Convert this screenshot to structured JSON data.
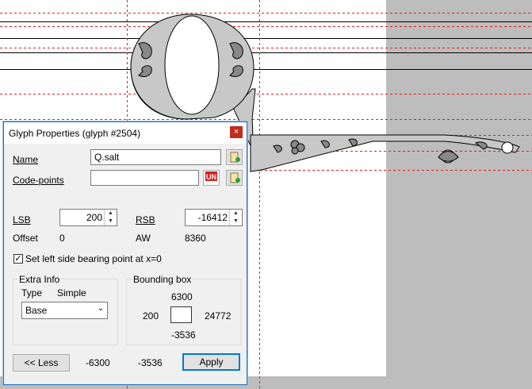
{
  "dialog": {
    "title": "Glyph Properties (glyph #2504)",
    "close_glyph": "×",
    "name_label": "Name",
    "name_value": "Q.salt",
    "codepoints_label": "Code-points",
    "codepoints_value": "",
    "lsb_label": "LSB",
    "lsb_value": "200",
    "rsb_label": "RSB",
    "rsb_value": "-16412",
    "offset_label": "Offset",
    "offset_value": "0",
    "aw_label": "AW",
    "aw_value": "8360",
    "checkbox_label": "Set left side bearing point at x=0",
    "checkbox_checked": true,
    "extra_info_title": "Extra Info",
    "type_label": "Type",
    "type_value": "Simple",
    "glyph_class": "Base",
    "bbox_title": "Bounding box",
    "bbox_top": "6300",
    "bbox_left": "200",
    "bbox_right": "24772",
    "bbox_bottom": "-3536",
    "less_button": "<< Less",
    "footer_x": "-6300",
    "footer_y": "-3536",
    "apply_button": "Apply"
  },
  "icons": {
    "paste": "paste-icon",
    "unicode": "unicode-icon",
    "unicode_text": "UN"
  }
}
